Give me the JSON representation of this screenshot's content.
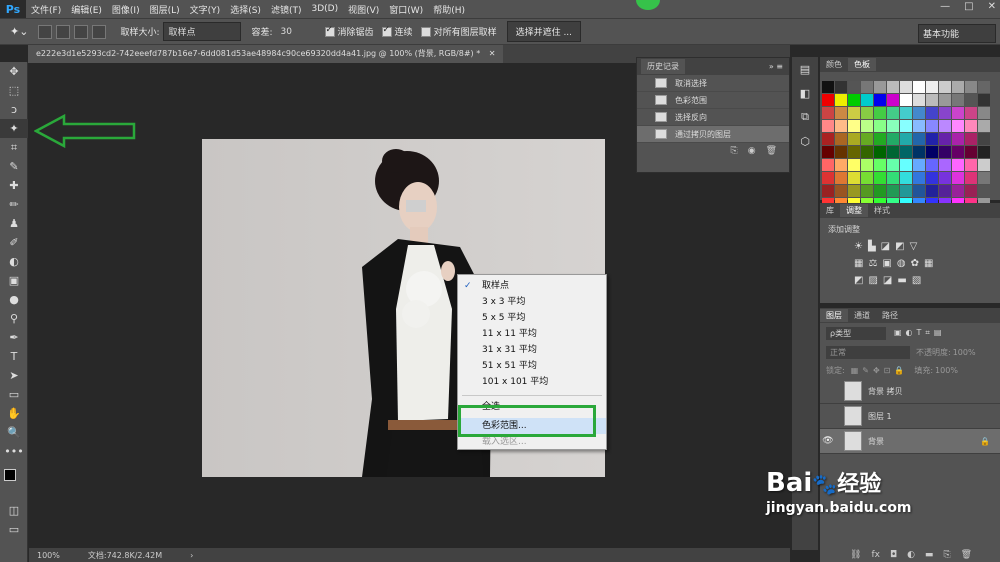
{
  "app": {
    "logo": "Ps"
  },
  "menubar": [
    "文件(F)",
    "编辑(E)",
    "图像(I)",
    "图层(L)",
    "文字(Y)",
    "选择(S)",
    "滤镜(T)",
    "3D(D)",
    "视图(V)",
    "窗口(W)",
    "帮助(H)"
  ],
  "window_controls": [
    "—",
    "□",
    "✕"
  ],
  "options": {
    "sample_size_label": "取样大小:",
    "sample_size_value": "取样点",
    "tolerance_label": "容差:",
    "tolerance_value": "30",
    "antialias_label": "消除锯齿",
    "contiguous_label": "连续",
    "sample_all_label": "对所有图层取样",
    "select_mask_label": "选择并遮住 ...",
    "workspace": "基本功能"
  },
  "doc_tab": "e222e3d1e5293cd2-742eeefd787b16e7-6dd081d53ae48984c90ce69320dd4a41.jpg @ 100% (背景, RGB/8#) *",
  "tools": [
    "✥",
    "⬚",
    "ↄ",
    "✦",
    "⌗",
    "✎",
    "✚",
    "✏",
    "♟",
    "✐",
    "◐",
    "▣",
    "●",
    "⚲",
    "✒",
    "T",
    "➤",
    "▭",
    "✋",
    "🔍",
    "•••"
  ],
  "context_menu": {
    "items": [
      "取样点",
      "3 x 3 平均",
      "5 x 5 平均",
      "11 x 11 平均",
      "31 x 31 平均",
      "51 x 51 平均",
      "101 x 101 平均"
    ],
    "checked_index": 0,
    "select_all": "全选",
    "color_range": "色彩范围...",
    "load_selection": "载入选区..."
  },
  "history": {
    "tab": "历史记录",
    "items": [
      "取消选择",
      "色彩范围",
      "选择反向",
      "通过拷贝的图层"
    ],
    "selected_index": 3
  },
  "swatches": {
    "tabs": [
      "颜色",
      "色板"
    ],
    "active": 1
  },
  "adjustments": {
    "tabs": [
      "库",
      "调整",
      "样式"
    ],
    "active": 1,
    "title": "添加调整"
  },
  "layers": {
    "tabs": [
      "图层",
      "通道",
      "路径"
    ],
    "kind_filter": "ρ类型",
    "blend_mode": "正常",
    "opacity_label": "不透明度:",
    "opacity_value": "100%",
    "lock_label": "锁定:",
    "fill_label": "填充:",
    "fill_value": "100%",
    "items": [
      "背景 拷贝",
      "图层 1",
      "背景"
    ],
    "selected_index": 2
  },
  "status": {
    "zoom": "100%",
    "doc": "文档:742.8K/2.42M"
  },
  "watermark": {
    "brand": "Bai",
    "brand_cn": "经验",
    "url": "jingyan.baidu.com"
  },
  "colors": {
    "annotation_green": "#2aa83a",
    "ps_blue": "#31a8ff"
  }
}
